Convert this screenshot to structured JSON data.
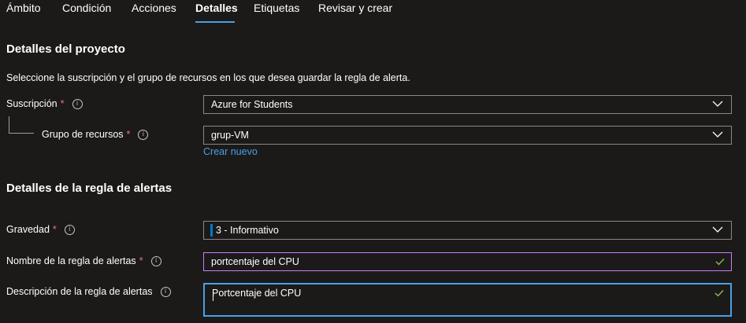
{
  "tabs": [
    {
      "label": "Ámbito"
    },
    {
      "label": "Condición"
    },
    {
      "label": "Acciones"
    },
    {
      "label": "Detalles",
      "active": true
    },
    {
      "label": "Etiquetas"
    },
    {
      "label": "Revisar y crear"
    }
  ],
  "project": {
    "heading": "Detalles del proyecto",
    "description": "Seleccione la suscripción y el grupo de recursos en los que desea guardar la regla de alerta.",
    "subscription": {
      "label": "Suscripción",
      "required": "*",
      "value": "Azure for Students"
    },
    "resource_group": {
      "label": "Grupo de recursos",
      "required": "*",
      "value": "grup-VM",
      "create_new": "Crear nuevo"
    }
  },
  "rule": {
    "heading": "Detalles de la regla de alertas",
    "severity": {
      "label": "Gravedad",
      "required": "*",
      "value": "3 - Informativo",
      "color": "#0078d4"
    },
    "name": {
      "label": "Nombre de la regla de alertas",
      "required": "*",
      "value": "portcentaje del CPU"
    },
    "description": {
      "label": "Descripción de la regla de alertas",
      "value": "Portcentaje del CPU"
    }
  },
  "colors": {
    "accent": "#4aa0e6",
    "required": "#f1707b",
    "valid_check": "#92c353",
    "name_border": "#c77dff"
  }
}
